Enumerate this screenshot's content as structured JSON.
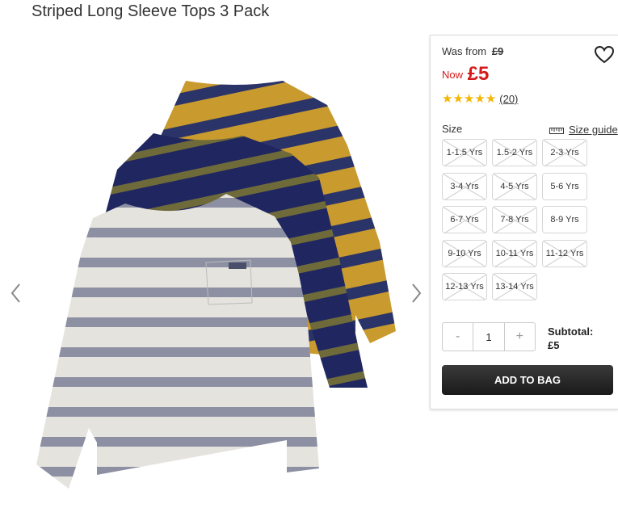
{
  "product": {
    "title": "Striped Long Sleeve Tops 3 Pack"
  },
  "pricing": {
    "was_label": "Was from",
    "was_price": "£9",
    "now_label": "Now",
    "now_price": "£5",
    "now_color": "#d41a1a"
  },
  "rating": {
    "stars": 5,
    "max": 5,
    "reviews": "(20)",
    "star_color": "#f2b705"
  },
  "size": {
    "label": "Size",
    "guide_label": "Size guide",
    "options": [
      {
        "label": "1-1.5 Yrs",
        "available": false
      },
      {
        "label": "1.5-2 Yrs",
        "available": false
      },
      {
        "label": "2-3 Yrs",
        "available": false
      },
      {
        "label": "3-4 Yrs",
        "available": false
      },
      {
        "label": "4-5 Yrs",
        "available": false
      },
      {
        "label": "5-6 Yrs",
        "available": true
      },
      {
        "label": "6-7 Yrs",
        "available": false
      },
      {
        "label": "7-8 Yrs",
        "available": false
      },
      {
        "label": "8-9 Yrs",
        "available": true
      },
      {
        "label": "9-10 Yrs",
        "available": false
      },
      {
        "label": "10-11 Yrs",
        "available": false
      },
      {
        "label": "11-12 Yrs",
        "available": false
      },
      {
        "label": "12-13 Yrs",
        "available": false
      },
      {
        "label": "13-14 Yrs",
        "available": false
      }
    ]
  },
  "quantity": {
    "minus": "-",
    "value": "1",
    "plus": "+"
  },
  "subtotal": {
    "label": "Subtotal:",
    "value": "£5"
  },
  "cart": {
    "add_label": "ADD TO BAG"
  },
  "gallery": {
    "icons": [
      "chevron-left-icon",
      "chevron-right-icon"
    ]
  }
}
